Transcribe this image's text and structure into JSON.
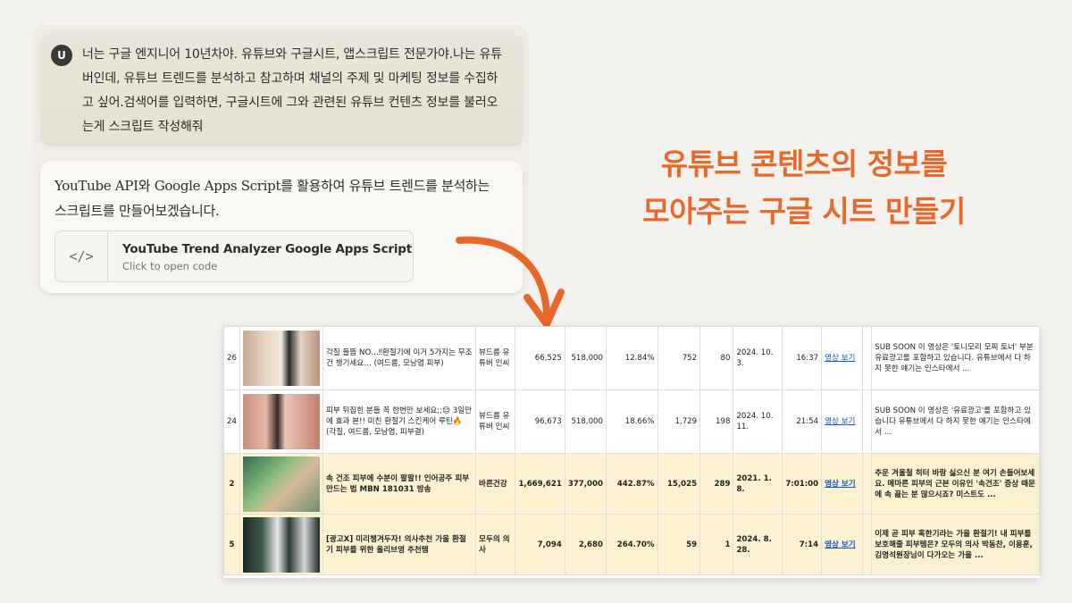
{
  "chat": {
    "avatar_letter": "U",
    "user_message": "너는 구글 엔지니어 10년차야. 유튜브와 구글시트, 앱스크립트 전문가야.나는 유튜버인데, 유튜브 트렌드를 분석하고 참고하며 채널의 주제 및 마케팅 정보를 수집하고 싶어.검색어를 입력하면, 구글시트에 그와 관련된 유튜브 컨텐츠 정보를 불러오는게 스크립트 작성해줘",
    "assistant_message": "YouTube API와 Google Apps Script를 활용하여 유튜브 트렌드를 분석하는 스크립트를 만들어보겠습니다.",
    "artifact": {
      "icon": "</>",
      "title": "YouTube Trend Analyzer Google Apps Script",
      "subtitle": "Click to open code"
    }
  },
  "headline": {
    "line1": "유튜브 콘텐츠의 정보를",
    "line2": "모아주는 구글 시트 만들기"
  },
  "accent_color": "#e8672a",
  "sheet": {
    "rows": [
      {
        "rank": "26",
        "thumb_caption": "",
        "title": "각질 들뜸 NO…‼환절기에 이거 5가지는 무조건 챙기세요… (여드름, 모낭염 피부)",
        "channel": "뷰드름 유튜버 인씨",
        "views": "66,525",
        "subscribers": "518,000",
        "ratio": "12.84%",
        "likes": "752",
        "comments": "80",
        "date": "2024. 10. 3.",
        "duration": "16:37",
        "link": "영상 보기",
        "description": "SUB SOON   이 영상은 '토니모리 모찌 토너' 부분 유료광고를 포함하고 있습니다. 유튜브에서 다 하지 못한 얘기는 인스타에서 ...",
        "highlight": false
      },
      {
        "rank": "24",
        "thumb_caption": "",
        "title": "피부 뒤집힌 분들 꼭 한번만 보세요;;😔  3일만에 효과 본!! 미친 환절기 스킨케어 루틴🔥 (각질, 여드름, 모낭염, 피부결)",
        "channel": "뷰드름 유튜버 인씨",
        "views": "96,673",
        "subscribers": "518,000",
        "ratio": "18.66%",
        "likes": "1,729",
        "comments": "198",
        "date": "2024. 10. 11.",
        "duration": "21:54",
        "link": "영상 보기",
        "description": "SUB SOON   이 영상은 '유료광고'를 포함하고 있습니다 유튜브에서 다 하지 못한 얘기는 인스타에서 ...",
        "highlight": false
      },
      {
        "rank": "2",
        "thumb_caption": "",
        "title": "속 건조 피부에 수분이 팔팔!! 인어공주 피부 만드는 법 MBN 181031 방송",
        "channel": "바른건강",
        "views": "1,669,621",
        "subscribers": "377,000",
        "ratio": "442.87%",
        "likes": "15,025",
        "comments": "289",
        "date": "2021. 1. 8.",
        "duration": "7:01:00",
        "link": "영상 보기",
        "description": "추운 겨울철 히터 바람 싫으신 분 여기 손들어보세요. 메마른 피부의 근본 이유인 '속건조' 증상 때문에 속 끓는 분 많으시죠? 미스트도 ...",
        "highlight": true
      },
      {
        "rank": "5",
        "thumb_caption": "",
        "title": "[광고X] 미리챙겨두자! 의사추천 가을 환절기 피부를 위한 올리브영 추천템",
        "channel": "모두의 의사",
        "views": "7,094",
        "subscribers": "2,680",
        "ratio": "264.70%",
        "likes": "59",
        "comments": "1",
        "date": "2024. 8. 28.",
        "duration": "7:14",
        "link": "영상 보기",
        "description": "이제 곧 피부 혹한기라는 가을 환절기! 내 피부를 보호해줄 피부템은? 모두의 의사 박동찬, 이용훈, 김명석원장님이 다가오는 가을 ...",
        "highlight": true
      }
    ]
  }
}
